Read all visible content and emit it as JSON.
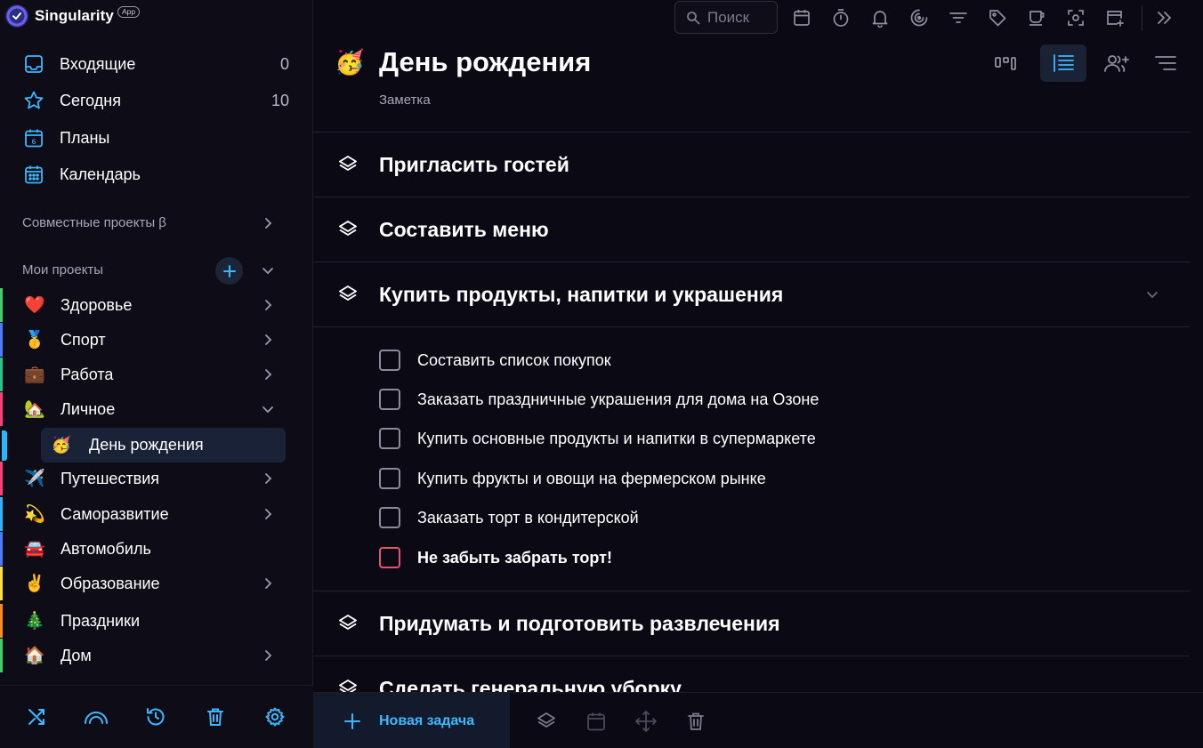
{
  "brand": {
    "name": "Singularity",
    "badge": "App"
  },
  "nav": [
    {
      "label": "Входящие",
      "count": "0"
    },
    {
      "label": "Сегодня",
      "count": "10"
    },
    {
      "label": "Планы",
      "count": ""
    },
    {
      "label": "Календарь",
      "count": ""
    }
  ],
  "nav_icon_texts": {
    "plans_day": "6"
  },
  "shared_section": {
    "title": "Совместные проекты β"
  },
  "my_projects": {
    "title": "Мои проекты",
    "items": [
      {
        "emoji": "❤️",
        "label": "Здоровье",
        "color": "#3ecf6a"
      },
      {
        "emoji": "🥇",
        "label": "Спорт",
        "color": "#4a7bff"
      },
      {
        "emoji": "💼",
        "label": "Работа",
        "color": "#25c48a"
      },
      {
        "emoji": "🏡",
        "label": "Личное",
        "color": "#ff3d7a"
      },
      {
        "emoji": "✈️",
        "label": "Путешествия",
        "color": "#ff3d7a"
      },
      {
        "emoji": "💫",
        "label": "Саморазвитие",
        "color": "#29b6ff"
      },
      {
        "emoji": "🚘",
        "label": "Автомобиль",
        "color": "#4a7bff"
      },
      {
        "emoji": "✌️",
        "label": "Образование",
        "color": "#ffe033"
      },
      {
        "emoji": "🎄",
        "label": "Праздники",
        "color": "#ff8c1a"
      },
      {
        "emoji": "🏠",
        "label": "Дом",
        "color": "#3ecf6a"
      }
    ],
    "subproject": {
      "emoji": "🥳",
      "label": "День рождения"
    }
  },
  "search": {
    "placeholder": "Поиск"
  },
  "page": {
    "emoji": "🥳",
    "title": "День рождения",
    "subtitle": "Заметка"
  },
  "groups": [
    {
      "label": "Пригласить гостей"
    },
    {
      "label": "Составить меню"
    },
    {
      "label": "Купить продукты, напитки и украшения"
    },
    {
      "label": "Придумать и подготовить развлечения"
    },
    {
      "label": "Сделать генеральную уборку"
    }
  ],
  "tasks": [
    {
      "label": "Составить список покупок",
      "urgent": false
    },
    {
      "label": "Заказать праздничные украшения для дома на Озоне",
      "urgent": false
    },
    {
      "label": "Купить основные продукты и напитки в супермаркете",
      "urgent": false
    },
    {
      "label": "Купить фрукты и овощи на фермерском рынке",
      "urgent": false
    },
    {
      "label": "Заказать торт в кондитерской",
      "urgent": false
    },
    {
      "label": "Не забыть забрать торт!",
      "urgent": true
    }
  ],
  "bottombar": {
    "new_task": "Новая задача"
  },
  "colors": {
    "accent": "#3db8ff",
    "urgent": "#e0566e",
    "sidebar_active": "#192237"
  }
}
